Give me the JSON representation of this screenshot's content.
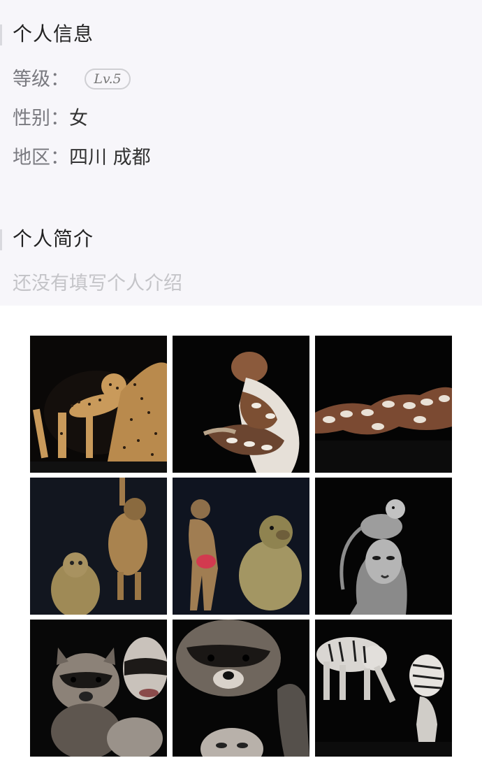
{
  "profile": {
    "info_title": "个人信息",
    "level_label": "等级：",
    "level_badge": "Lv.5",
    "gender_label": "性别：",
    "gender_value": "女",
    "region_label": "地区：",
    "region_value": "四川 成都",
    "intro_title": "个人简介",
    "intro_placeholder": "还没有填写个人介绍"
  },
  "gallery": {
    "photos": [
      "cheetah-bodypaint-photo",
      "python-bodypaint-photo",
      "reclining-python-bodypaint-photo",
      "hanging-monkey-photo",
      "baboon-bodypaint-photo",
      "squirrel-monkey-bodypaint-photo",
      "raccoon-bodypaint-photo",
      "raccoon-closeup-photo",
      "white-tiger-bodypaint-photo"
    ]
  }
}
